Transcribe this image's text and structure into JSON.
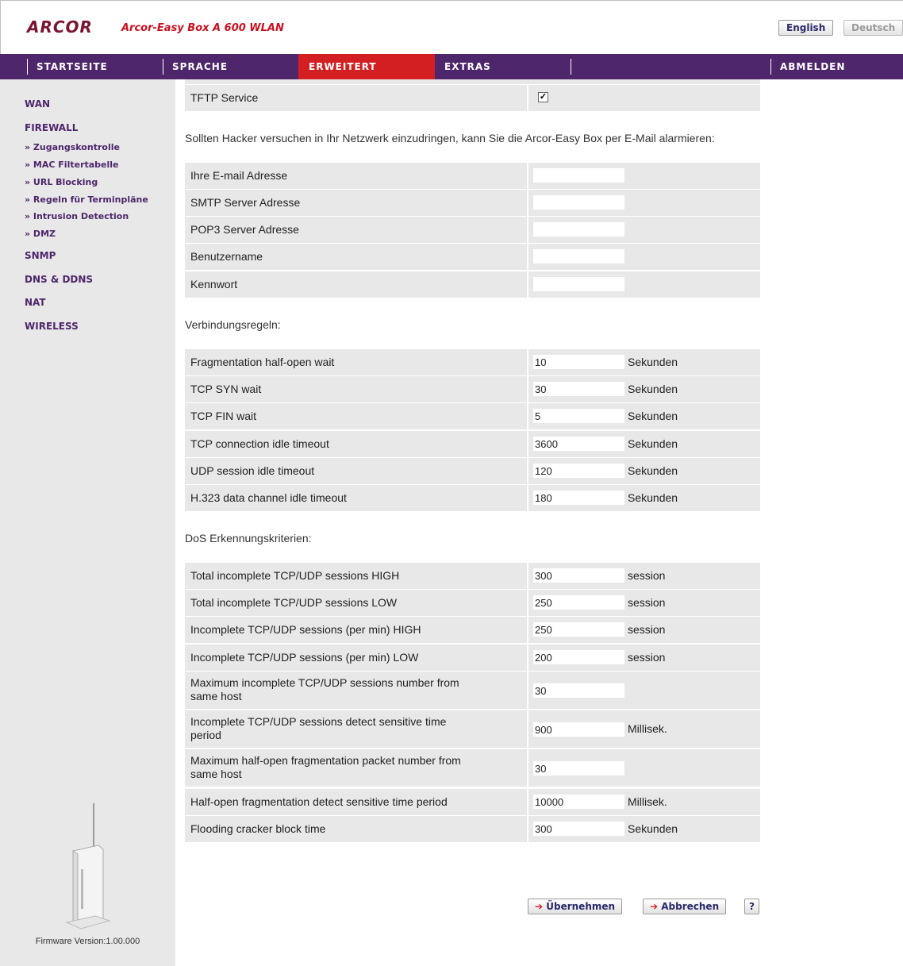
{
  "header": {
    "logo": "ARCOR",
    "product": "Arcor-Easy Box A 600 WLAN",
    "lang_english": "English",
    "lang_deutsch": "Deutsch"
  },
  "nav": {
    "startseite": "STARTSEITE",
    "sprache": "SPRACHE",
    "erweitert": "ERWEITERT",
    "extras": "EXTRAS",
    "abmelden": "ABMELDEN"
  },
  "sidebar": {
    "wan": "WAN",
    "firewall": "FIREWALL",
    "sub": [
      "» Zugangskontrolle",
      "» MAC Filtertabelle",
      "» URL Blocking",
      "» Regeln für Terminpläne",
      "» Intrusion Detection",
      "» DMZ"
    ],
    "snmp": "SNMP",
    "dns": "DNS & DDNS",
    "nat": "NAT",
    "wireless": "WIRELESS",
    "firmware": "Firmware Version:1.00.000"
  },
  "tftp": {
    "label": "TFTP Service",
    "checked": true
  },
  "alert_text": "Sollten Hacker versuchen in Ihr Netzwerk einzudringen, kann Sie die Arcor-Easy Box per E-Mail alarmieren:",
  "email": [
    {
      "label": "Ihre E-mail Adresse",
      "value": ""
    },
    {
      "label": "SMTP Server Adresse",
      "value": ""
    },
    {
      "label": "POP3 Server Adresse",
      "value": ""
    },
    {
      "label": "Benutzername",
      "value": ""
    },
    {
      "label": "Kennwort",
      "value": ""
    }
  ],
  "conn_title": "Verbindungsregeln:",
  "conn": [
    {
      "label": "Fragmentation half-open wait",
      "value": "10",
      "unit": "Sekunden"
    },
    {
      "label": "TCP SYN wait",
      "value": "30",
      "unit": "Sekunden"
    },
    {
      "label": "TCP FIN wait",
      "value": "5",
      "unit": "Sekunden"
    },
    {
      "label": "TCP connection idle timeout",
      "value": "3600",
      "unit": "Sekunden"
    },
    {
      "label": "UDP session idle timeout",
      "value": "120",
      "unit": "Sekunden"
    },
    {
      "label": "H.323 data channel idle timeout",
      "value": "180",
      "unit": "Sekunden"
    }
  ],
  "dos_title": "DoS Erkennungskriterien:",
  "dos": [
    {
      "label": "Total incomplete TCP/UDP sessions HIGH",
      "value": "300",
      "unit": "session"
    },
    {
      "label": "Total incomplete TCP/UDP sessions LOW",
      "value": "250",
      "unit": "session"
    },
    {
      "label": "Incomplete TCP/UDP sessions (per min) HIGH",
      "value": "250",
      "unit": "session"
    },
    {
      "label": "Incomplete TCP/UDP sessions (per min) LOW",
      "value": "200",
      "unit": "session"
    },
    {
      "label": "Maximum incomplete TCP/UDP sessions number from same host",
      "value": "30",
      "unit": ""
    },
    {
      "label": "Incomplete TCP/UDP sessions detect sensitive time period",
      "value": "900",
      "unit": "Millisek."
    },
    {
      "label": "Maximum half-open fragmentation packet number from same host",
      "value": "30",
      "unit": ""
    },
    {
      "label": "Half-open fragmentation detect sensitive time period",
      "value": "10000",
      "unit": "Millisek."
    },
    {
      "label": "Flooding cracker block time",
      "value": "300",
      "unit": "Sekunden"
    }
  ],
  "actions": {
    "apply_arrow": "➔",
    "apply": "Übernehmen",
    "cancel_arrow": "➔",
    "cancel": "Abbrechen",
    "help": "?"
  }
}
